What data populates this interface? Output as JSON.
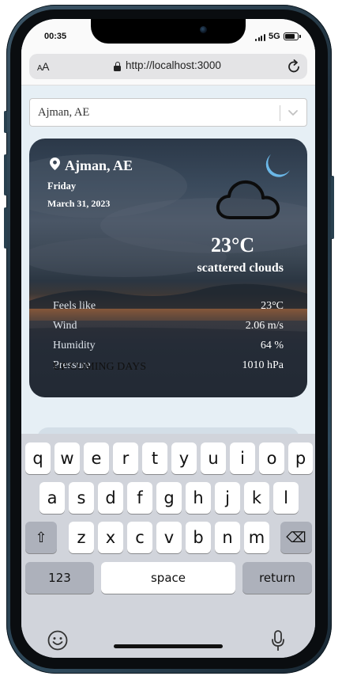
{
  "status_bar": {
    "time": "00:35",
    "network": "5G",
    "battery_level": 0.85
  },
  "browser": {
    "text_size_label_small": "A",
    "text_size_label_large": "A",
    "url": "http://localhost:3000",
    "icons": [
      "lock-icon",
      "reload-icon"
    ]
  },
  "city_select": {
    "value": "Ajman, AE",
    "icon": "chevron-down-icon"
  },
  "weather": {
    "city": "Ajman, AE",
    "day": "Friday",
    "date": "March 31, 2023",
    "temperature": "23°C",
    "description": "scattered clouds",
    "icons": [
      "location-pin-icon",
      "moon-icon",
      "cloud-icon"
    ],
    "accent_color": "#6bb8e8",
    "details": [
      {
        "label": "Feels like",
        "value": "23°C"
      },
      {
        "label": "Wind",
        "value": "2.06 m/s"
      },
      {
        "label": "Humidity",
        "value": "64 %"
      },
      {
        "label": "Pressure",
        "value": "1010 hPa"
      }
    ]
  },
  "upcoming": {
    "title": "UP COMING DAYS"
  },
  "keyboard": {
    "row1": [
      "q",
      "w",
      "e",
      "r",
      "t",
      "y",
      "u",
      "i",
      "o",
      "p"
    ],
    "row2": [
      "a",
      "s",
      "d",
      "f",
      "g",
      "h",
      "j",
      "k",
      "l"
    ],
    "row3": [
      "z",
      "x",
      "c",
      "v",
      "b",
      "n",
      "m"
    ],
    "shift_label": "⇧",
    "backspace_label": "⌫",
    "numbers_label": "123",
    "space_label": "space",
    "return_label": "return",
    "icons": [
      "emoji-icon",
      "mic-icon"
    ]
  }
}
